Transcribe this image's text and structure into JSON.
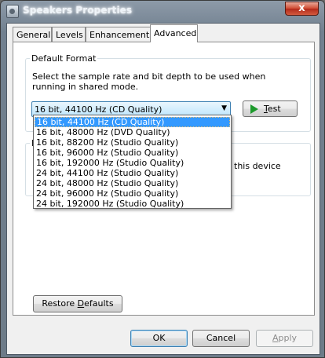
{
  "window": {
    "title": "Speakers Properties",
    "close_glyph": "x",
    "icon": "speaker-icon"
  },
  "tabs": [
    {
      "label": "General",
      "active": false
    },
    {
      "label": "Levels",
      "active": false
    },
    {
      "label": "Enhancements",
      "active": false
    },
    {
      "label": "Advanced",
      "active": true
    }
  ],
  "default_format": {
    "title": "Default Format",
    "description": "Select the sample rate and bit depth to be used when running in shared mode.",
    "selected_value": "16 bit, 44100 Hz (CD Quality)",
    "dropdown_arrow": "▼",
    "test_button": {
      "mnemonic": "T",
      "rest": "est",
      "icon": "play-icon"
    },
    "options": [
      "16 bit, 44100 Hz (CD Quality)",
      "16 bit, 48000 Hz (DVD Quality)",
      "16 bit, 88200 Hz (Studio Quality)",
      "16 bit, 96000 Hz (Studio Quality)",
      "16 bit, 192000 Hz (Studio Quality)",
      "24 bit, 44100 Hz (Studio Quality)",
      "24 bit, 48000 Hz (Studio Quality)",
      "24 bit, 96000 Hz (Studio Quality)",
      "24 bit, 192000 Hz (Studio Quality)"
    ]
  },
  "exclusive_mode": {
    "title_fragment": "E",
    "text_fragment": "this device"
  },
  "restore_defaults": {
    "before": "Restore ",
    "mnemonic": "D",
    "after": "efaults"
  },
  "footer": {
    "ok_label": "OK",
    "cancel_label": "Cancel",
    "apply_mnemonic": "A",
    "apply_rest": "pply"
  }
}
